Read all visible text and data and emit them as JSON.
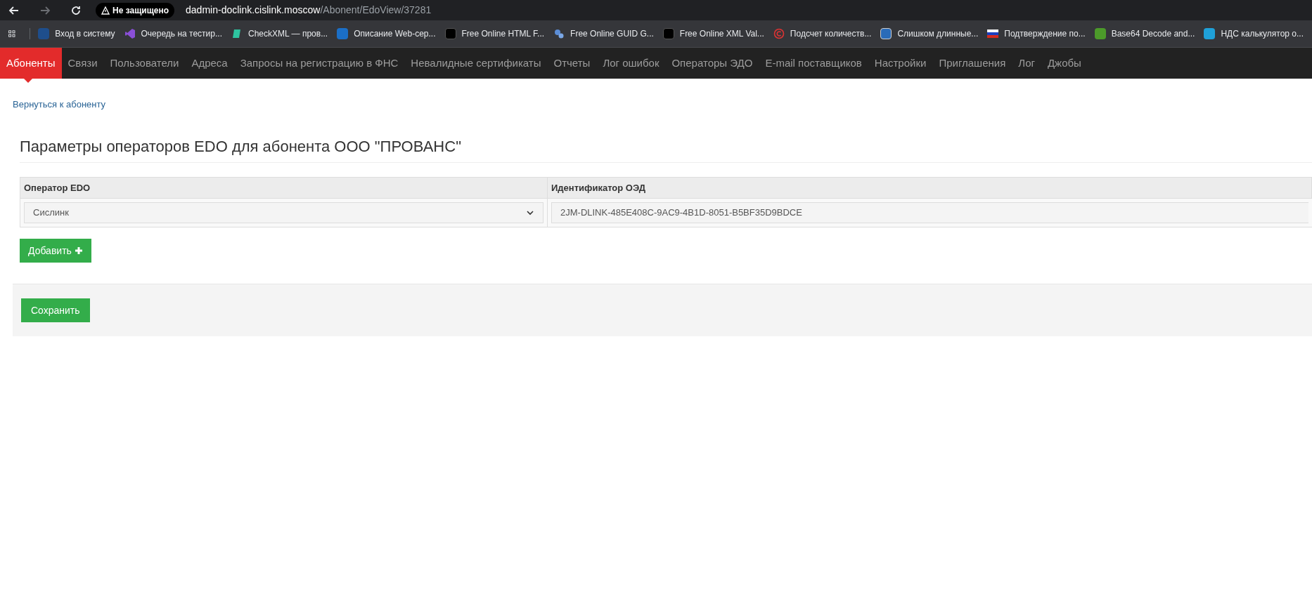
{
  "browser": {
    "security_label": "Не защищено",
    "url_host": "dadmin-doclink.cislink.moscow",
    "url_path": "/Abonent/EdoView/37281"
  },
  "bookmarks": [
    "Вход в систему",
    "Очередь на тестир...",
    "CheckXML — пров...",
    "Описание Web-сер...",
    "Free Online HTML F...",
    "Free Online GUID G...",
    "Free Online XML Val...",
    "Подсчет количеств...",
    "Слишком длинные...",
    "Подтверждение по...",
    "Base64 Decode and...",
    "НДС калькулятор о..."
  ],
  "nav": [
    {
      "label": "Абоненты",
      "selected": true
    },
    {
      "label": "Связи",
      "selected": false
    },
    {
      "label": "Пользователи",
      "selected": false
    },
    {
      "label": "Адреса",
      "selected": false
    },
    {
      "label": "Запросы на регистрацию в ФНС",
      "selected": false
    },
    {
      "label": "Невалидные сертификаты",
      "selected": false
    },
    {
      "label": "Отчеты",
      "selected": false
    },
    {
      "label": "Лог ошибок",
      "selected": false
    },
    {
      "label": "Операторы ЭДО",
      "selected": false
    },
    {
      "label": "E-mail поставщиков",
      "selected": false
    },
    {
      "label": "Настройки",
      "selected": false
    },
    {
      "label": "Приглашения",
      "selected": false
    },
    {
      "label": "Лог",
      "selected": false
    },
    {
      "label": "Джобы",
      "selected": false
    }
  ],
  "back_link": "Вернуться к абоненту",
  "heading": "Параметры операторов EDO для абонента ООО \"ПРОВАНС\"",
  "table": {
    "columns": [
      "Оператор EDO",
      "Идентификатор ОЭД"
    ],
    "rows": [
      {
        "operator": "Сислинк",
        "identifier": "2JM-DLINK-485E408C-9AC9-4B1D-8051-B5BF35D9BDCE"
      }
    ]
  },
  "add_button": "Добавить",
  "save_button": "Сохранить"
}
